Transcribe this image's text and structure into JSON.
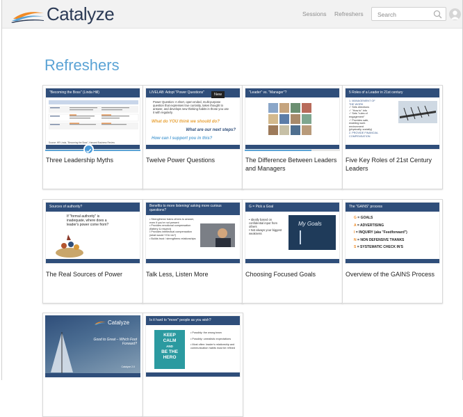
{
  "header": {
    "logo_text": "Catalyze",
    "nav": [
      {
        "label": "Sessions"
      },
      {
        "label": "Refreshers"
      }
    ],
    "search": {
      "placeholder": "Search",
      "value": ""
    },
    "brand_colors": {
      "navy": "#2b3a55",
      "accent": "#5ba3d5",
      "orange": "#f08a24"
    }
  },
  "page": {
    "title": "Refreshers"
  },
  "cards": [
    {
      "title": "Three Leadership Myths",
      "slide_heading": "\"Becoming the Boss\" (Linda Hill)",
      "progress": 1.0,
      "completed": true,
      "footer": "Source: HR Linda, \"Becoming the Boss\", Harvard Business Review"
    },
    {
      "title": "Twelve Power Questions",
      "slide_heading": "LIVELAB: Adopt \"Power Questions\"",
      "badge": "New",
      "slide_body": "Power Question: A short, open-ended, multi-purpose question that expresses true curiosity, takes thought to answer, and develops new thinking habits in those you use it with regularly.",
      "slide_q1": "What do YOU think we should do?",
      "slide_q2": "What are our next steps?",
      "slide_q3": "How can I support you in this?"
    },
    {
      "title": "The Difference Between Leaders and Managers",
      "slide_heading": "\"Leader\" vs. \"Manager\"?",
      "progress": 0.7
    },
    {
      "title": "Five Key Roles of 21st Century Leaders",
      "slide_heading": "5 Roles of a Leader in 21st century",
      "slide_lines": [
        "1.  MANAGEMENT OF",
        "    THE WORK",
        "  ✓ Sets directions",
        "  ✓ \"How to\" info",
        "  ✓ Sets \"rules of",
        "     engagement\"",
        "  ✓ Provides safe,",
        "     enabling work",
        "     environment",
        "     (physically, socially)",
        "2.  PROVIDE FINANCIAL",
        "    COMPENSATION"
      ]
    },
    {
      "title": "The Real Sources of Power",
      "slide_heading": "Sources of authority?",
      "slide_text": "If \"formal authority\" is inadequate, where does a leader's power come from?"
    },
    {
      "title": "Talk Less, Listen More",
      "slide_heading": "Benefits to more listening/ asking more curious questions?",
      "slide_lines": [
        "• Strengthens/ trains others to answer, even if you're not present",
        "• Provides emotional compensation (flattery & respect)",
        "• Provides intellectual compensation (what would YOU do?)",
        "• Builds trust / strengthens relationships"
      ]
    },
    {
      "title": "Choosing Focused Goals",
      "slide_heading": "G = Pick a Goal",
      "slide_lines": [
        "• Ideally based on confidential input from others",
        "• Not always your biggest weakness"
      ],
      "board_text": "My Goals"
    },
    {
      "title": "Overview of the GAINS Process",
      "slide_heading": "The \"GAINS\" process",
      "gains": [
        {
          "letter": "G",
          "text": "= GOALS"
        },
        {
          "letter": "A",
          "text": "= ADVERTISING"
        },
        {
          "letter": "I",
          "text": "= INQUIRY (aka \"Feedforward\")"
        },
        {
          "letter": "N",
          "text": "= NON DEFENSIVE THANKS"
        },
        {
          "letter": "S",
          "text": "= SYSTEMATIC CHECK IN'S"
        }
      ]
    },
    {
      "title": "",
      "slide_logo": "Catalyze",
      "slide_text": "Good to Great – Which Foot Forward?",
      "slide_sub": "Catalyze 2.0"
    },
    {
      "title": "",
      "slide_heading": "Is it hard to \"move\" people as you wish?",
      "poster": [
        "KEEP",
        "CALM",
        "AND",
        "BE THE",
        "HERO"
      ],
      "slide_lines": [
        "• Possibly: the wrong team",
        "• Possibly: unrealistic expectations",
        "• Most often: leader's relationship and communication habits must be refined"
      ]
    }
  ]
}
